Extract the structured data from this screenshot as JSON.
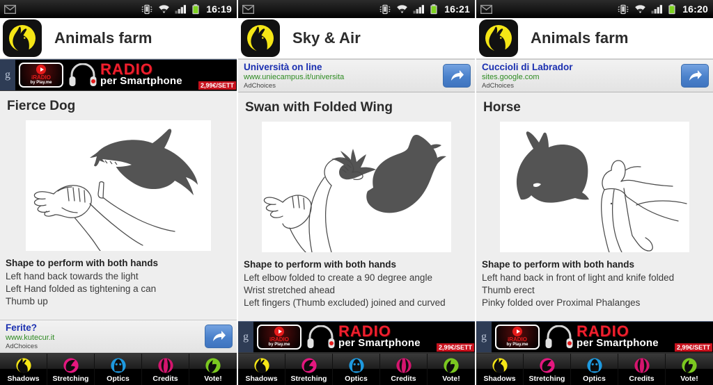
{
  "panels": [
    {
      "status": {
        "time": "16:19",
        "mail_icon": "mail-icon",
        "vibrate_icon": "vibrate-icon",
        "wifi_icon": "wifi-icon",
        "signal_icon": "signal-icon",
        "battery_icon": "battery-icon"
      },
      "app": {
        "title": "Animals farm",
        "logo_icon": "app-logo-rabbit-shadow-icon"
      },
      "top_banner": {
        "type": "radio-banner",
        "google_mark": "g",
        "logo_label": "iRADIO",
        "logo_sub": "by Play.me",
        "headline": "RADIO",
        "subline": "per Smartphone",
        "price": "2,99€/SETT"
      },
      "shape": {
        "title": "Fierce Dog",
        "image_alt": "fierce-dog-hand-shadow-illustration",
        "desc_heading": "Shape to perform with both hands",
        "desc_lines": [
          "Left hand back towards the light",
          "Left Hand folded as tightening a can",
          "Thumb up"
        ]
      },
      "bottom_banner": {
        "type": "text-ad",
        "title": "Ferite?",
        "url": "www.kutecur.it",
        "choices": "AdChoices",
        "arrow_icon": "share-arrow-icon"
      }
    },
    {
      "status": {
        "time": "16:21",
        "mail_icon": "mail-icon",
        "vibrate_icon": "vibrate-icon",
        "wifi_icon": "wifi-icon",
        "signal_icon": "signal-icon",
        "battery_icon": "battery-icon"
      },
      "app": {
        "title": "Sky & Air",
        "logo_icon": "app-logo-rabbit-shadow-icon"
      },
      "top_banner": {
        "type": "text-ad",
        "title": "Università on line",
        "url": "www.uniecampus.it/universita",
        "choices": "AdChoices",
        "arrow_icon": "share-arrow-icon"
      },
      "shape": {
        "title": "Swan with Folded Wing",
        "image_alt": "swan-with-folded-wing-hand-shadow-illustration",
        "desc_heading": "Shape to perform with both hands",
        "desc_lines": [
          "Left elbow folded to create a 90 degree angle",
          "Wrist stretched ahead",
          "Left fingers (Thumb excluded) joined and curved"
        ]
      },
      "bottom_banner": {
        "type": "radio-banner",
        "google_mark": "g",
        "logo_label": "iRADIO",
        "logo_sub": "by Play.me",
        "headline": "RADIO",
        "subline": "per Smartphone",
        "price": "2,99€/SETT"
      }
    },
    {
      "status": {
        "time": "16:20",
        "mail_icon": "mail-icon",
        "vibrate_icon": "vibrate-icon",
        "wifi_icon": "wifi-icon",
        "signal_icon": "signal-icon",
        "battery_icon": "battery-icon"
      },
      "app": {
        "title": "Animals farm",
        "logo_icon": "app-logo-rabbit-shadow-icon"
      },
      "top_banner": {
        "type": "text-ad",
        "title": "Cuccioli di Labrador",
        "url": "sites.google.com",
        "choices": "AdChoices",
        "arrow_icon": "share-arrow-icon"
      },
      "shape": {
        "title": "Horse",
        "image_alt": "horse-hand-shadow-illustration",
        "desc_heading": "Shape to perform with both hands",
        "desc_lines": [
          "Left hand back in front of light and knife folded",
          "Thumb erect",
          "Pinky folded over Proximal Phalanges"
        ]
      },
      "bottom_banner": {
        "type": "radio-banner",
        "google_mark": "g",
        "logo_label": "iRADIO",
        "logo_sub": "by Play.me",
        "headline": "RADIO",
        "subline": "per Smartphone",
        "price": "2,99€/SETT"
      }
    }
  ],
  "nav": {
    "items": [
      {
        "label": "Shadows",
        "icon": "shadows-rabbit-icon",
        "color": "#f5e616"
      },
      {
        "label": "Stretching",
        "icon": "stretching-hand-icon",
        "color": "#e5177f"
      },
      {
        "label": "Optics",
        "icon": "optics-icon",
        "color": "#1e9ae0"
      },
      {
        "label": "Credits",
        "icon": "credits-icon",
        "color": "#d4156e"
      },
      {
        "label": "Vote!",
        "icon": "vote-thumbsup-icon",
        "color": "#7bc820"
      }
    ]
  },
  "colors": {
    "accent_yellow": "#f5e616",
    "ad_title_blue": "#1a2fb0",
    "ad_url_green": "#2e8b22",
    "shadow_gray": "#545454",
    "banner_red": "#ef1f2e",
    "button_blue": "#4a81cb"
  }
}
